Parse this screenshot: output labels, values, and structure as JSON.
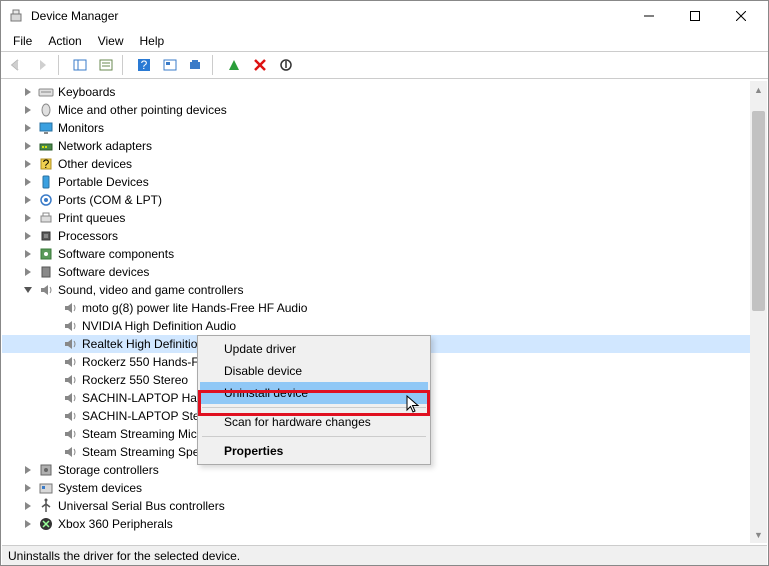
{
  "window": {
    "title": "Device Manager"
  },
  "menu": {
    "file": "File",
    "action": "Action",
    "view": "View",
    "help": "Help"
  },
  "tree": {
    "items": [
      {
        "indent": 20,
        "caret": "col",
        "icon": "keyboard",
        "label": "Keyboards"
      },
      {
        "indent": 20,
        "caret": "col",
        "icon": "mouse",
        "label": "Mice and other pointing devices"
      },
      {
        "indent": 20,
        "caret": "col",
        "icon": "monitor",
        "label": "Monitors"
      },
      {
        "indent": 20,
        "caret": "col",
        "icon": "network",
        "label": "Network adapters"
      },
      {
        "indent": 20,
        "caret": "col",
        "icon": "other",
        "label": "Other devices"
      },
      {
        "indent": 20,
        "caret": "col",
        "icon": "portable",
        "label": "Portable Devices"
      },
      {
        "indent": 20,
        "caret": "col",
        "icon": "port",
        "label": "Ports (COM & LPT)"
      },
      {
        "indent": 20,
        "caret": "col",
        "icon": "printq",
        "label": "Print queues"
      },
      {
        "indent": 20,
        "caret": "col",
        "icon": "cpu",
        "label": "Processors"
      },
      {
        "indent": 20,
        "caret": "col",
        "icon": "swcomp",
        "label": "Software components"
      },
      {
        "indent": 20,
        "caret": "col",
        "icon": "swdev",
        "label": "Software devices"
      },
      {
        "indent": 20,
        "caret": "exp",
        "icon": "sound",
        "label": "Sound, video and game controllers"
      },
      {
        "indent": 44,
        "caret": "",
        "icon": "sound",
        "label": "moto g(8) power lite Hands-Free HF Audio"
      },
      {
        "indent": 44,
        "caret": "",
        "icon": "sound",
        "label": "NVIDIA High Definition Audio"
      },
      {
        "indent": 44,
        "caret": "",
        "icon": "sound",
        "label": "Realtek High Definitio",
        "sel": true
      },
      {
        "indent": 44,
        "caret": "",
        "icon": "sound",
        "label": "Rockerz 550 Hands-Fr"
      },
      {
        "indent": 44,
        "caret": "",
        "icon": "sound",
        "label": "Rockerz 550 Stereo"
      },
      {
        "indent": 44,
        "caret": "",
        "icon": "sound",
        "label": "SACHIN-LAPTOP Han"
      },
      {
        "indent": 44,
        "caret": "",
        "icon": "sound",
        "label": "SACHIN-LAPTOP Ster"
      },
      {
        "indent": 44,
        "caret": "",
        "icon": "sound",
        "label": "Steam Streaming Micr"
      },
      {
        "indent": 44,
        "caret": "",
        "icon": "sound",
        "label": "Steam Streaming Spea"
      },
      {
        "indent": 20,
        "caret": "col",
        "icon": "storage",
        "label": "Storage controllers"
      },
      {
        "indent": 20,
        "caret": "col",
        "icon": "system",
        "label": "System devices"
      },
      {
        "indent": 20,
        "caret": "col",
        "icon": "usb",
        "label": "Universal Serial Bus controllers"
      },
      {
        "indent": 20,
        "caret": "col",
        "icon": "xbox",
        "label": "Xbox 360 Peripherals"
      }
    ]
  },
  "contextmenu": {
    "items": [
      {
        "label": "Update driver"
      },
      {
        "label": "Disable device"
      },
      {
        "label": "Uninstall device",
        "sel": true,
        "highlighted": true
      },
      {
        "divider": true
      },
      {
        "label": "Scan for hardware changes"
      },
      {
        "divider": true
      },
      {
        "label": "Properties",
        "bold": true
      }
    ]
  },
  "status": {
    "text": "Uninstalls the driver for the selected device."
  }
}
